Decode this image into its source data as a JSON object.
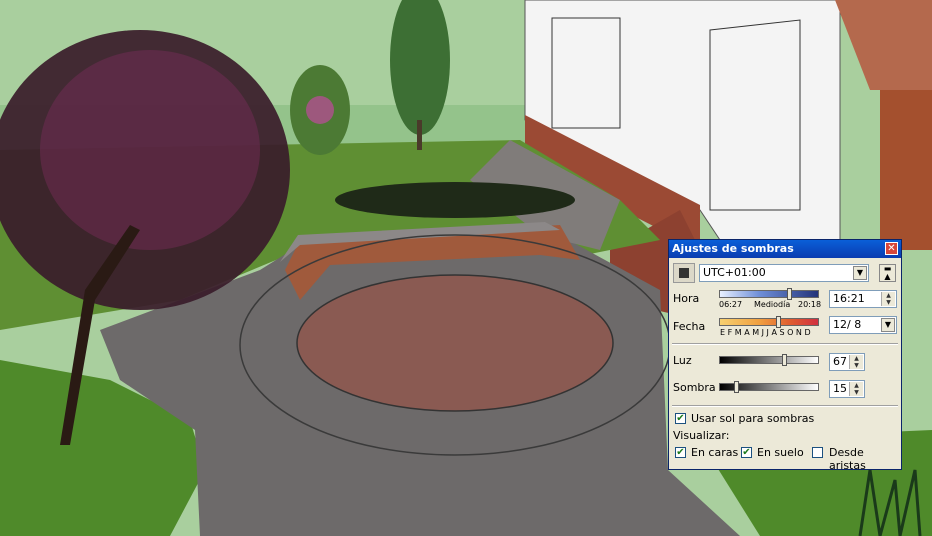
{
  "dialog": {
    "title": "Ajustes de sombras",
    "timezone": "UTC+01:00",
    "time": {
      "label": "Hora",
      "sunrise": "06:27",
      "noon": "Mediodía",
      "sunset": "20:18",
      "value": "16:21",
      "slider_fraction": 0.72
    },
    "date": {
      "label": "Fecha",
      "months": "E F M A M J J A S O N D",
      "value": "12/ 8",
      "slider_fraction": 0.6
    },
    "light": {
      "label": "Luz",
      "value": "67",
      "slider_fraction": 0.67
    },
    "shadow": {
      "label": "Sombra",
      "value": "15",
      "slider_fraction": 0.15
    },
    "use_sun": {
      "label": "Usar sol para sombras",
      "checked": true
    },
    "display_label": "Visualizar:",
    "on_faces": {
      "label": "En caras",
      "checked": true
    },
    "on_ground": {
      "label": "En suelo",
      "checked": true
    },
    "from_edges": {
      "label": "Desde aristas",
      "checked": false
    }
  },
  "colors": {
    "title_bar": "#0a4cc8",
    "dialog_bg": "#ece9d8",
    "grass": "#6b9a3a",
    "paving": "#6d6a6a",
    "brick_circle": "#8a5a52"
  }
}
